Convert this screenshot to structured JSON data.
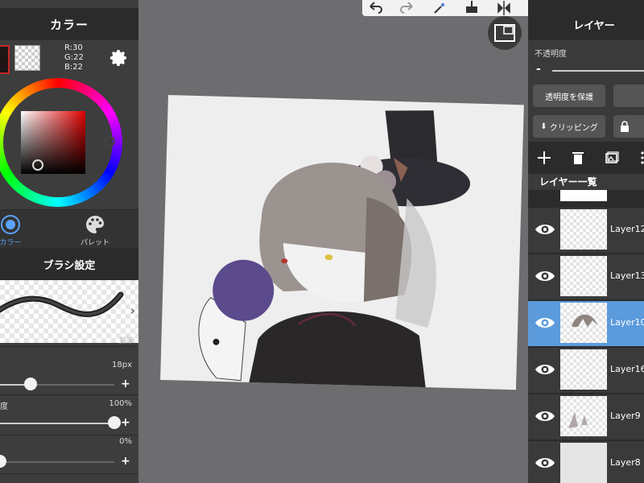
{
  "left_panel": {
    "title": "カラー",
    "rgb": {
      "r": "R:30",
      "g": "G:22",
      "b": "B:22"
    },
    "foreground_color": "#1e1616",
    "tabs": [
      {
        "label": "カラー",
        "icon": "color-circle-icon",
        "active": true
      },
      {
        "label": "パレット",
        "icon": "palette-icon",
        "active": false
      }
    ],
    "brush_header": "ブラシ設定",
    "brush_name": "鉛筆",
    "size": {
      "value": "18px",
      "level": 0.27
    },
    "opacity": {
      "label": "度",
      "value": "100%",
      "level": 1.0
    },
    "blur": {
      "value": "0%",
      "level": 0.0
    }
  },
  "toolbar": {
    "icons": [
      "undo-icon",
      "redo-icon",
      "magic-wand-icon",
      "paste-icon",
      "flip-icon",
      "lasso-off-icon",
      "transform-icon",
      "export-icon",
      "more-icon"
    ]
  },
  "right_panel": {
    "title": "レイヤー",
    "opacity_label": "不透明度",
    "opacity_minus": "-",
    "protect_button": "透明度を保護",
    "clipping_button": "クリッピング",
    "lock_icon": "lock-icon",
    "list_header": "レイヤー一覧",
    "layers": [
      {
        "name": "Layer12",
        "selected": false
      },
      {
        "name": "Layer13",
        "selected": false
      },
      {
        "name": "Layer10",
        "selected": true
      },
      {
        "name": "Layer16",
        "selected": false
      },
      {
        "name": "Layer9",
        "selected": false
      },
      {
        "name": "Layer8",
        "selected": false
      }
    ],
    "selected_color": "#5b9bdc"
  }
}
